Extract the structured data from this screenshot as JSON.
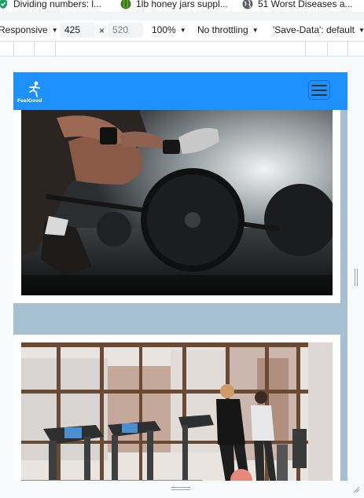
{
  "bookmarks": [
    {
      "label": "Dividing numbers: l...",
      "icon": "shield-check-icon",
      "color": "#1aa160"
    },
    {
      "label": "1lb honey jars suppl...",
      "icon": "melon-icon",
      "color": "#3f7a1c"
    },
    {
      "label": "51 Worst Diseases a...",
      "icon": "globe-icon",
      "color": "#5f6368"
    }
  ],
  "device_toolbar": {
    "device": "Responsive",
    "width": "425",
    "times": "×",
    "height": "520",
    "zoom": "100%",
    "throttling": "No throttling",
    "save_data": "'Save-Data': default"
  },
  "site": {
    "brand": "FeelGood",
    "nav_color": "#1e90ff",
    "background_color": "#a7c0d1"
  },
  "cards": [
    {
      "image": "Gym photo: athlete squatting beside a loaded barbell"
    },
    {
      "image": "Gym photo: people walking on treadmills by large windows"
    }
  ]
}
